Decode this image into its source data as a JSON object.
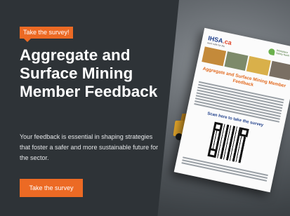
{
  "banner": {
    "tag_label": "Take the survey!",
    "title": "Aggregate and Surface Mining Member Feedback",
    "description": "Your feedback is essential in shaping strategies that foster a safer and more sustainable future for the sector.",
    "cta_label": "Take the survey"
  },
  "flyer": {
    "logo_primary": "IHSA",
    "logo_primary_suffix": ".ca",
    "logo_primary_tagline": "work safe for life",
    "logo_secondary": "Workplace Safety North",
    "headline": "Aggregate and Surface Mining Member Feedback",
    "scan_prompt": "Scan here to take the survey"
  },
  "colors": {
    "accent": "#ec6a24",
    "panel": "#2e3337",
    "flyer_headline": "#e26a1f",
    "flyer_scan": "#1f3f8a"
  },
  "icons": [
    "ihsa-logo",
    "workplace-safety-north-logo",
    "qr-code"
  ]
}
